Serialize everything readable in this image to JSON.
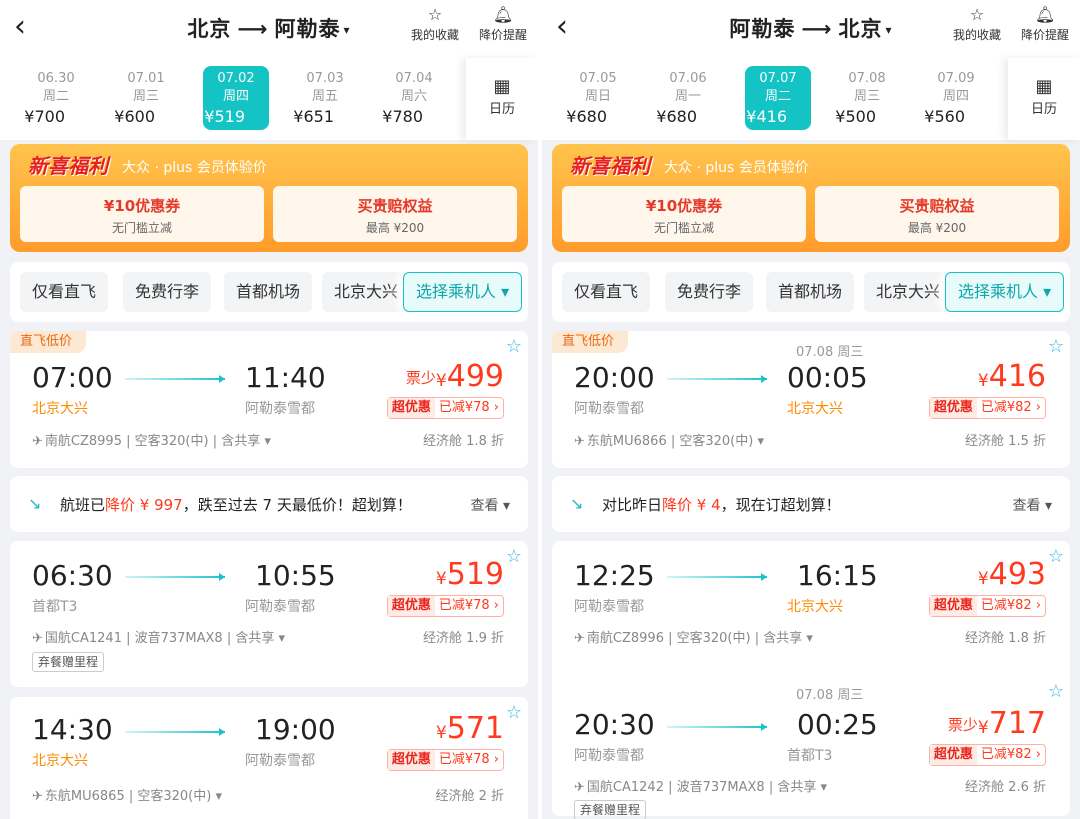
{
  "left": {
    "route": {
      "from": "北京",
      "to": "阿勒泰",
      "caret": "▾"
    },
    "fav_label": "我的收藏",
    "alert_label": "降价提醒",
    "dates": [
      {
        "date": "06.30",
        "weekday": "周二",
        "price": "¥700"
      },
      {
        "date": "07.01",
        "weekday": "周三",
        "price": "¥600"
      },
      {
        "date": "07.02",
        "weekday": "周四",
        "price": "¥519"
      },
      {
        "date": "07.03",
        "weekday": "周五",
        "price": "¥651"
      },
      {
        "date": "07.04",
        "weekday": "周六",
        "price": "¥780"
      }
    ],
    "selected_index": 2,
    "calendar_label": "日历",
    "promo": {
      "title": "新喜福利",
      "subtitle": "大众 · plus 会员体验价",
      "coupon1_title": "¥10优惠券",
      "coupon1_sub": "无门槛立减",
      "coupon2_title": "买贵赔权益",
      "coupon2_sub": "最高 ¥200"
    },
    "filters": [
      "仅看直飞",
      "免费行李",
      "首都机场",
      "北京大兴"
    ],
    "passenger_label": "选择乘机人 ▾",
    "flights": [
      {
        "tag": "直飞低价",
        "dep_time": "07:00",
        "arr_time": "11:40",
        "dep_airport": "北京大兴",
        "arr_airport": "阿勒泰雪都",
        "few": "票少",
        "price": "499",
        "deal_a": "超优惠",
        "deal_b": "已减¥78 ›",
        "airline": "南航CZ8995 | 空客320(中) | 含共享 ▾",
        "cabin": "经济舱 1.8 折"
      },
      {
        "dep_time": "06:30",
        "arr_time": "10:55",
        "dep_airport": "首都T3",
        "arr_airport": "阿勒泰雪都",
        "price": "519",
        "deal_a": "超优惠",
        "deal_b": "已减¥78 ›",
        "airline": "国航CA1241 | 波音737MAX8 | 含共享 ▾",
        "cabin": "经济舱 1.9 折",
        "perk": "弃餐赠里程"
      },
      {
        "dep_time": "14:30",
        "arr_time": "19:00",
        "dep_airport": "北京大兴",
        "arr_airport": "阿勒泰雪都",
        "price": "571",
        "deal_a": "超优惠",
        "deal_b": "已减¥78 ›",
        "airline": "东航MU6865 | 空客320(中) ▾",
        "cabin": "经济舱 2 折"
      }
    ],
    "notice": {
      "pre": "航班已",
      "hl": "降价 ¥ 997",
      "post": "，跌至过去 7 天最低价！超划算！",
      "more": "查看 ▾"
    }
  },
  "right": {
    "route": {
      "from": "阿勒泰",
      "to": "北京",
      "caret": "▾"
    },
    "fav_label": "我的收藏",
    "alert_label": "降价提醒",
    "dates": [
      {
        "date": "07.05",
        "weekday": "周日",
        "price": "¥680"
      },
      {
        "date": "07.06",
        "weekday": "周一",
        "price": "¥680"
      },
      {
        "date": "07.07",
        "weekday": "周二",
        "price": "¥416"
      },
      {
        "date": "07.08",
        "weekday": "周三",
        "price": "¥500"
      },
      {
        "date": "07.09",
        "weekday": "周四",
        "price": "¥560"
      }
    ],
    "selected_index": 2,
    "calendar_label": "日历",
    "promo": {
      "title": "新喜福利",
      "subtitle": "大众 · plus 会员体验价",
      "coupon1_title": "¥10优惠券",
      "coupon1_sub": "无门槛立减",
      "coupon2_title": "买贵赔权益",
      "coupon2_sub": "最高 ¥200"
    },
    "filters": [
      "仅看直飞",
      "免费行李",
      "首都机场",
      "北京大兴"
    ],
    "passenger_label": "选择乘机人 ▾",
    "flights": [
      {
        "tag": "直飞低价",
        "next_day": "07.08 周三",
        "dep_time": "20:00",
        "arr_time": "00:05",
        "dep_airport": "阿勒泰雪都",
        "arr_airport": "北京大兴",
        "price": "416",
        "deal_a": "超优惠",
        "deal_b": "已减¥82 ›",
        "airline": "东航MU6866 | 空客320(中) ▾",
        "cabin": "经济舱 1.5 折"
      },
      {
        "dep_time": "12:25",
        "arr_time": "16:15",
        "dep_airport": "阿勒泰雪都",
        "arr_airport": "北京大兴",
        "price": "493",
        "deal_a": "超优惠",
        "deal_b": "已减¥82 ›",
        "airline": "南航CZ8996 | 空客320(中) | 含共享 ▾",
        "cabin": "经济舱 1.8 折"
      },
      {
        "next_day": "07.08 周三",
        "dep_time": "20:30",
        "arr_time": "00:25",
        "dep_airport": "阿勒泰雪都",
        "arr_airport": "首都T3",
        "few": "票少",
        "price": "717",
        "deal_a": "超优惠",
        "deal_b": "已减¥82 ›",
        "airline": "国航CA1242 | 波音737MAX8 | 含共享 ▾",
        "cabin": "经济舱 2.6 折",
        "perk": "弃餐赠里程"
      }
    ],
    "notice": {
      "pre": "对比昨日",
      "hl": "降价 ¥ 4",
      "post": "，现在订超划算！",
      "more": "查看 ▾"
    }
  },
  "colors": {
    "accent": "#14c4c4",
    "price_red": "#ff3a1e",
    "orange": "#ff8a00"
  },
  "icons": {
    "back": "chevron-left-icon",
    "fav": "star-box-icon",
    "alert": "bell-icon",
    "calendar": "calendar-icon",
    "star": "star-outline-icon"
  }
}
